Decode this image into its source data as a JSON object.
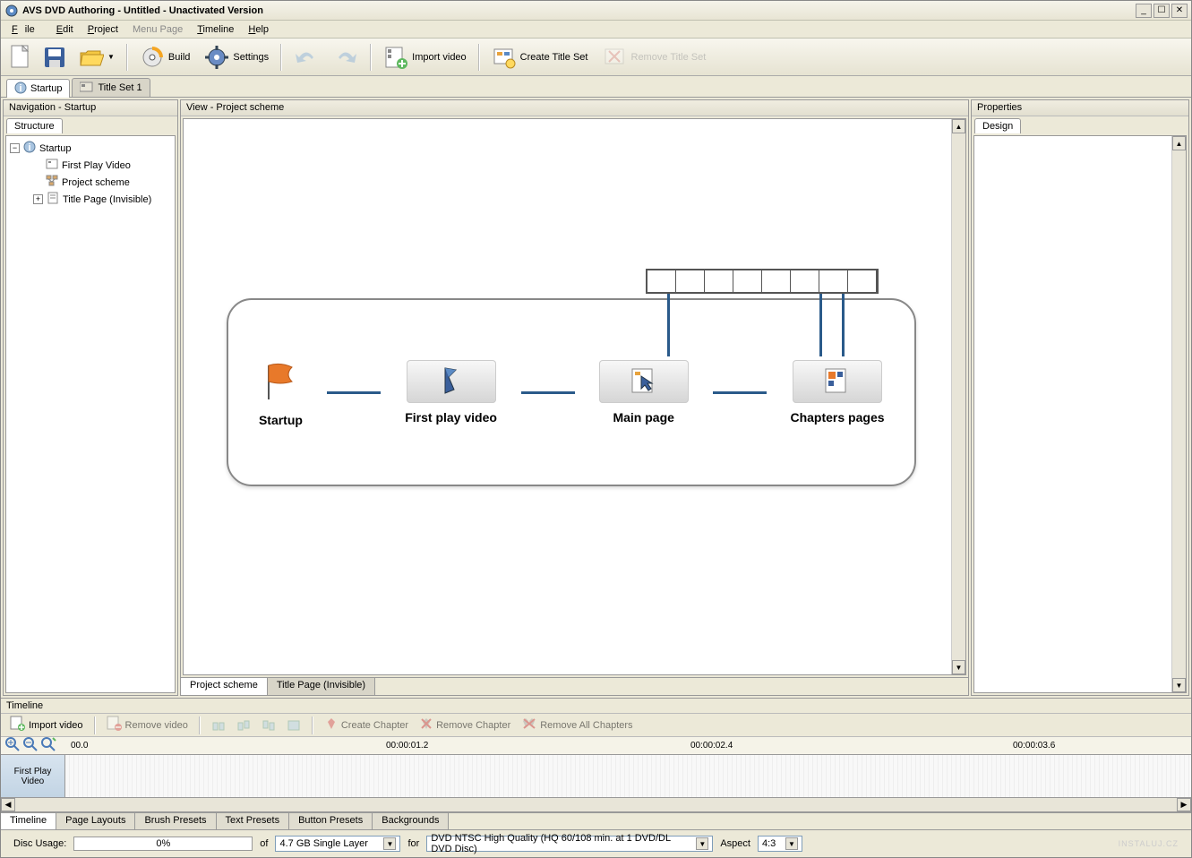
{
  "window": {
    "title": "AVS DVD Authoring - Untitled - Unactivated Version"
  },
  "menubar": {
    "file": "File",
    "edit": "Edit",
    "project": "Project",
    "menupage": "Menu Page",
    "timeline": "Timeline",
    "help": "Help"
  },
  "toolbar": {
    "build": "Build",
    "settings": "Settings",
    "import_video": "Import video",
    "create_title_set": "Create Title Set",
    "remove_title_set": "Remove Title Set"
  },
  "top_tabs": {
    "startup": "Startup",
    "titleset1": "Title Set 1"
  },
  "nav": {
    "title": "Navigation - Startup",
    "structure_tab": "Structure",
    "nodes": {
      "startup": "Startup",
      "first_play": "First Play Video",
      "project_scheme": "Project scheme",
      "title_page": "Title Page (Invisible)"
    }
  },
  "view": {
    "title": "View - Project scheme",
    "tabs": {
      "scheme": "Project scheme",
      "title_page": "Title Page (Invisible)"
    },
    "scheme": {
      "startup": "Startup",
      "first_play": "First play video",
      "main_page": "Main page",
      "chapters": "Chapters pages"
    }
  },
  "props": {
    "title": "Properties",
    "design_tab": "Design"
  },
  "timeline": {
    "title": "Timeline",
    "import_video": "Import video",
    "remove_video": "Remove video",
    "create_chapter": "Create Chapter",
    "remove_chapter": "Remove Chapter",
    "remove_all_chapters": "Remove All Chapters",
    "track_label": "First Play Video",
    "times": {
      "t0": "00.0",
      "t1": "00:00:01.2",
      "t2": "00:00:02.4",
      "t3": "00:00:03.6"
    }
  },
  "bottom_tabs": {
    "timeline": "Timeline",
    "page_layouts": "Page Layouts",
    "brush": "Brush Presets",
    "text": "Text  Presets",
    "button": "Button Presets",
    "backgrounds": "Backgrounds"
  },
  "status": {
    "disc_usage_label": "Disc Usage:",
    "disc_usage_pct": "0%",
    "of": "of",
    "disc_size": "4.7 GB Single Layer",
    "for": "for",
    "quality": "DVD NTSC High Quality (HQ 60/108 min. at 1 DVD/DL DVD Disc)",
    "aspect_label": "Aspect",
    "aspect": "4:3"
  },
  "watermark": "INSTALUJ.CZ"
}
